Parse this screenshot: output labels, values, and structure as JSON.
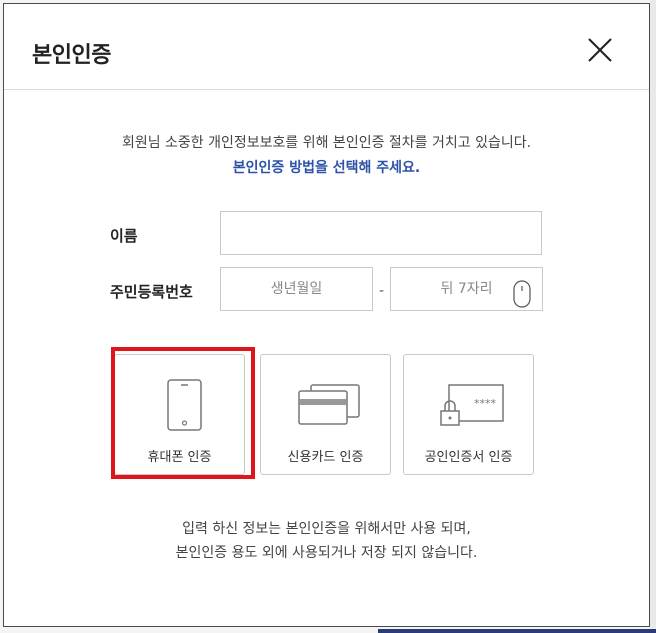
{
  "modal": {
    "title": "본인인증",
    "close_icon": "close-icon"
  },
  "intro": {
    "line1": "회원님 소중한 개인정보보호를 위해 본인인증 절차를 거치고 있습니다.",
    "line2": "본인인증 방법을 선택해 주세요."
  },
  "form": {
    "name_label": "이름",
    "name_value": "",
    "rrn_label": "주민등록번호",
    "birth_placeholder": "생년월일",
    "separator": "-",
    "back_placeholder": "뒤 7자리",
    "toggle_icon": "eye-toggle-icon"
  },
  "methods": [
    {
      "label": "휴대폰 인증",
      "icon": "mobile-phone-icon",
      "selected": true
    },
    {
      "label": "신용카드 인증",
      "icon": "credit-card-icon",
      "selected": false
    },
    {
      "label": "공인인증서 인증",
      "icon": "certificate-lock-icon",
      "selected": false
    }
  ],
  "notice": {
    "line1": "입력 하신 정보는 본인인증을 위해서만 사용 되며,",
    "line2": "본인인증 용도 외에 사용되거나 저장 되지 않습니다."
  },
  "colors": {
    "accent": "#2d52a8",
    "highlight": "#e0141b",
    "border": "#c9c9c9"
  }
}
